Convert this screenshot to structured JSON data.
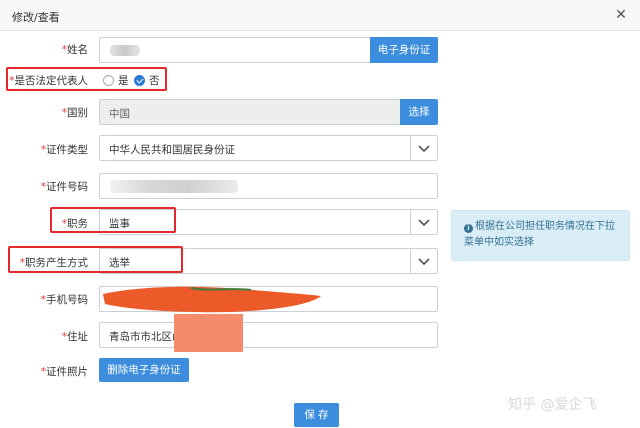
{
  "dialog": {
    "title": "修改/查看"
  },
  "form": {
    "name": {
      "label": "姓名",
      "button": "电子身份证"
    },
    "legal_rep": {
      "label": "是否法定代表人",
      "yes": "是",
      "no": "否"
    },
    "country": {
      "label": "国别",
      "value": "中国",
      "button": "选择"
    },
    "id_type": {
      "label": "证件类型",
      "value": "中华人民共和国居民身份证"
    },
    "id_number": {
      "label": "证件号码"
    },
    "position": {
      "label": "职务",
      "value": "监事"
    },
    "appointment": {
      "label": "职务产生方式",
      "value": "选举"
    },
    "phone": {
      "label": "手机号码"
    },
    "address": {
      "label": "住址",
      "value": "青岛市市北区山"
    },
    "id_photo": {
      "label": "证件照片",
      "button": "删除电子身份证"
    },
    "save_button": "保 存"
  },
  "tip": {
    "icon": "info-circle-icon",
    "text": "根据在公司担任职务情况在下拉菜单中如实选择"
  },
  "watermark": "知乎 @爱企飞",
  "colors": {
    "primary": "#3c8dde",
    "required": "#e23b3b",
    "highlight_box": "#e4282b",
    "tip_bg": "#d9edf7"
  }
}
